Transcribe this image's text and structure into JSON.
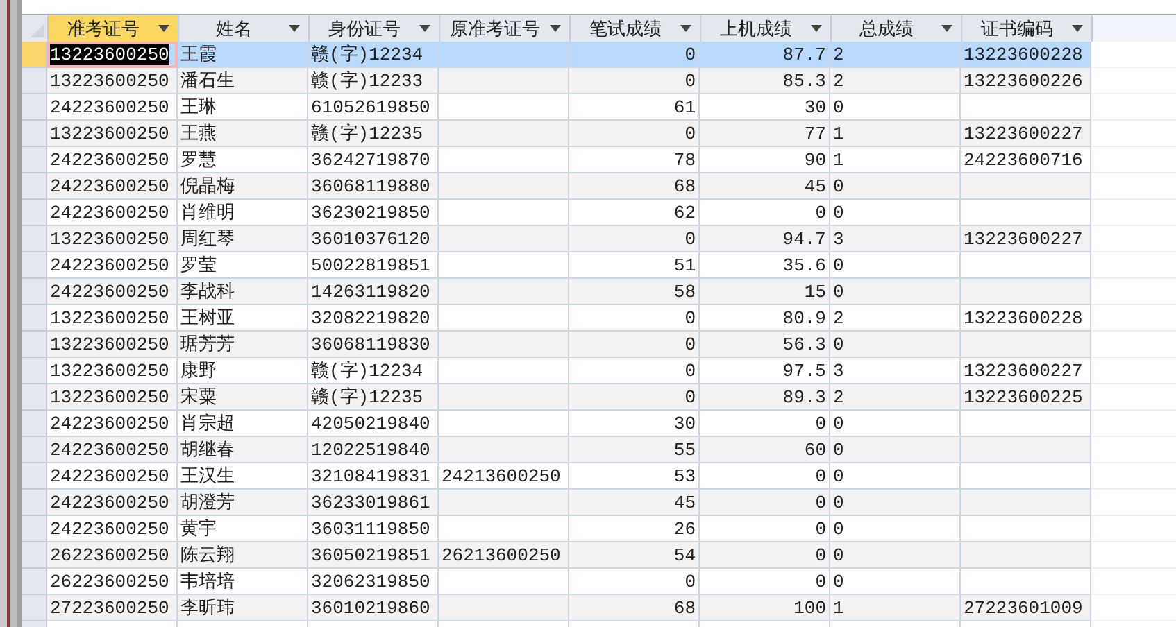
{
  "columns": [
    {
      "label": "准考证号",
      "selected": true,
      "kind": "text"
    },
    {
      "label": "姓名",
      "selected": false,
      "kind": "text"
    },
    {
      "label": "身份证号",
      "selected": false,
      "kind": "text"
    },
    {
      "label": "原准考证号",
      "selected": false,
      "kind": "text"
    },
    {
      "label": "笔试成绩",
      "selected": false,
      "kind": "number"
    },
    {
      "label": "上机成绩",
      "selected": false,
      "kind": "number"
    },
    {
      "label": "总成绩",
      "selected": false,
      "kind": "text"
    },
    {
      "label": "证书编码",
      "selected": false,
      "kind": "text"
    }
  ],
  "rows": [
    {
      "selected": true,
      "cells": [
        "13223600250",
        "王霞",
        "赣(字)12234",
        null,
        "0",
        "87.7",
        "2",
        "13223600228"
      ]
    },
    {
      "selected": false,
      "cells": [
        "13223600250",
        "潘石生",
        "赣(字)12233",
        null,
        "0",
        "85.3",
        "2",
        "13223600226"
      ]
    },
    {
      "selected": false,
      "cells": [
        "24223600250",
        "王琳",
        "61052619850",
        null,
        "61",
        "30",
        "0",
        null
      ]
    },
    {
      "selected": false,
      "cells": [
        "13223600250",
        "王燕",
        "赣(字)12235",
        null,
        "0",
        "77",
        "1",
        "13223600227"
      ]
    },
    {
      "selected": false,
      "cells": [
        "24223600250",
        "罗慧",
        "36242719870",
        null,
        "78",
        "90",
        "1",
        "24223600716"
      ]
    },
    {
      "selected": false,
      "cells": [
        "24223600250",
        "倪晶梅",
        "36068119880",
        null,
        "68",
        "45",
        "0",
        null
      ]
    },
    {
      "selected": false,
      "cells": [
        "24223600250",
        "肖维明",
        "36230219850",
        null,
        "62",
        "0",
        "0",
        null
      ]
    },
    {
      "selected": false,
      "cells": [
        "13223600250",
        "周红琴",
        "36010376120",
        null,
        "0",
        "94.7",
        "3",
        "13223600227"
      ]
    },
    {
      "selected": false,
      "cells": [
        "24223600250",
        "罗莹",
        "50022819851",
        null,
        "51",
        "35.6",
        "0",
        null
      ]
    },
    {
      "selected": false,
      "cells": [
        "24223600250",
        "李战科",
        "14263119820",
        null,
        "58",
        "15",
        "0",
        null
      ]
    },
    {
      "selected": false,
      "cells": [
        "13223600250",
        "王树亚",
        "32082219820",
        null,
        "0",
        "80.9",
        "2",
        "13223600228"
      ]
    },
    {
      "selected": false,
      "cells": [
        "13223600250",
        "琚芳芳",
        "36068119830",
        null,
        "0",
        "56.3",
        "0",
        null
      ]
    },
    {
      "selected": false,
      "cells": [
        "13223600250",
        "康野",
        "赣(字)12234",
        null,
        "0",
        "97.5",
        "3",
        "13223600227"
      ]
    },
    {
      "selected": false,
      "cells": [
        "13223600250",
        "宋粟",
        "赣(字)12235",
        null,
        "0",
        "89.3",
        "2",
        "13223600225"
      ]
    },
    {
      "selected": false,
      "cells": [
        "24223600250",
        "肖宗超",
        "42050219840",
        null,
        "30",
        "0",
        "0",
        null
      ]
    },
    {
      "selected": false,
      "cells": [
        "24223600250",
        "胡继春",
        "12022519840",
        null,
        "55",
        "60",
        "0",
        null
      ]
    },
    {
      "selected": false,
      "cells": [
        "24223600250",
        "王汉生",
        "32108419831",
        "24213600250",
        "53",
        "0",
        "0",
        null
      ]
    },
    {
      "selected": false,
      "cells": [
        "24223600250",
        "胡澄芳",
        "36233019861",
        null,
        "45",
        "0",
        "0",
        null
      ]
    },
    {
      "selected": false,
      "cells": [
        "24223600250",
        "黄宇",
        "36031119850",
        null,
        "26",
        "0",
        "0",
        null
      ]
    },
    {
      "selected": false,
      "cells": [
        "26223600250",
        "陈云翔",
        "36050219851",
        "26213600250",
        "54",
        "0",
        "0",
        null
      ]
    },
    {
      "selected": false,
      "cells": [
        "26223600250",
        "韦培培",
        "32062319850",
        null,
        "0",
        "0",
        "0",
        null
      ]
    },
    {
      "selected": false,
      "cells": [
        "27223600250",
        "李昕玮",
        "36010219860",
        null,
        "68",
        "100",
        "1",
        "27223601009"
      ]
    }
  ]
}
